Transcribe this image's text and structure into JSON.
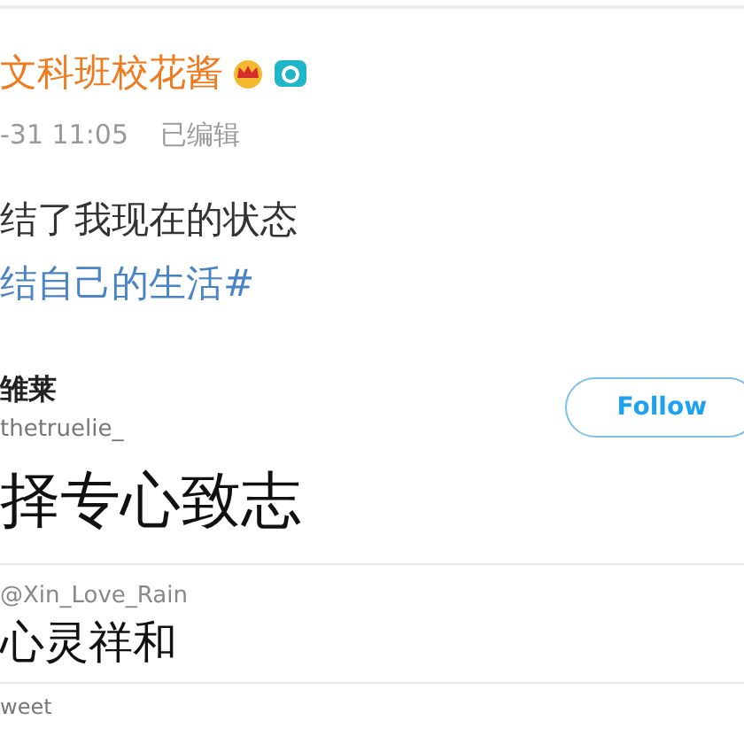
{
  "post": {
    "author": "文科班校花酱",
    "time": "-31 11:05",
    "edited": "已编辑",
    "lines": [
      "结了我现在的状态"
    ],
    "hashtag": "结自己的生活#"
  },
  "tweet": {
    "name": "雏莱",
    "handle": "thetruelie_",
    "follow": "Follow",
    "text": "择专心致志"
  },
  "reply": {
    "handle": "@Xin_Love_Rain",
    "text": "心灵祥和"
  },
  "footer": "weet"
}
